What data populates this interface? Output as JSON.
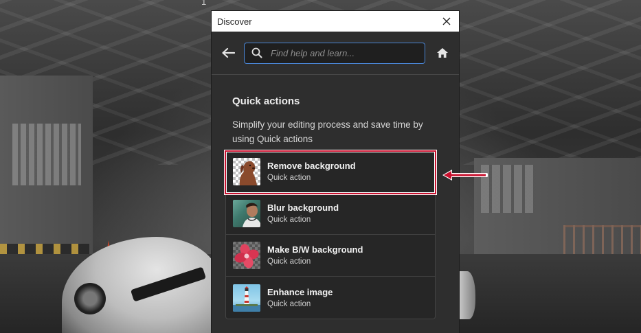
{
  "background": {
    "corner_text": "1"
  },
  "dialog": {
    "title": "Discover",
    "search": {
      "placeholder": "Find help and learn...",
      "value": ""
    },
    "quick_actions": {
      "heading": "Quick actions",
      "description": "Simplify your editing process and save time by using Quick actions",
      "items": [
        {
          "title": "Remove background",
          "subtitle": "Quick action",
          "icon": "dog-portrait-transparent-thumbnail"
        },
        {
          "title": "Blur background",
          "subtitle": "Quick action",
          "icon": "person-portrait-thumbnail"
        },
        {
          "title": "Make B/W background",
          "subtitle": "Quick action",
          "icon": "pink-flower-thumbnail"
        },
        {
          "title": "Enhance image",
          "subtitle": "Quick action",
          "icon": "lighthouse-thumbnail"
        }
      ]
    }
  },
  "annotation": {
    "highlight_color": "#c8102e",
    "highlighted_item": "Remove background"
  },
  "colors": {
    "dialog_bg": "#2e2e2e",
    "search_border": "#4a86d6",
    "titlebar_bg": "#ffffff"
  }
}
